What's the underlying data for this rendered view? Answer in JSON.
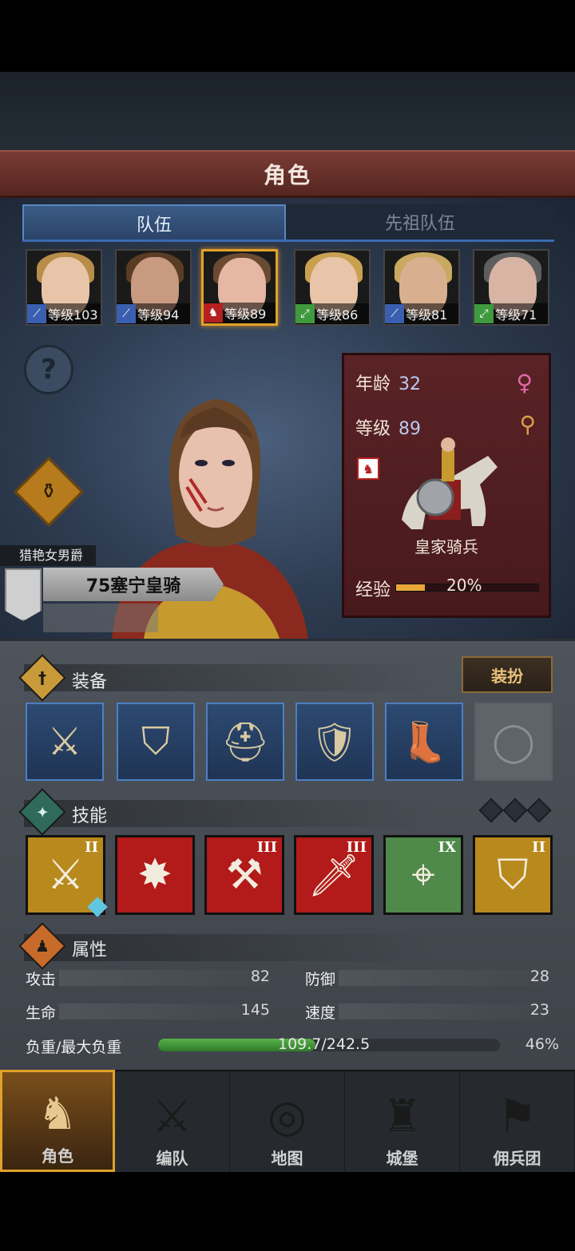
{
  "header": {
    "title": "角色"
  },
  "tabs": [
    {
      "label": "队伍"
    },
    {
      "label": "先祖队伍"
    }
  ],
  "party": [
    {
      "level_text": "等级103",
      "class_icon": "sword-icon",
      "class_color": "#3a5fb0",
      "hair": "#b88d4a",
      "skin": "#e8c4a8"
    },
    {
      "level_text": "等级94",
      "class_icon": "sword-icon",
      "class_color": "#3a5fb0",
      "hair": "#5a3c24",
      "skin": "#c89a80"
    },
    {
      "level_text": "等级89",
      "class_icon": "horse-icon",
      "class_color": "#b52020",
      "hair": "#6a4a30",
      "skin": "#e6b8a4"
    },
    {
      "level_text": "等级86",
      "class_icon": "bow-icon",
      "class_color": "#3f9a3f",
      "hair": "#c9a050",
      "skin": "#e8c4a8"
    },
    {
      "level_text": "等级81",
      "class_icon": "sword-icon",
      "class_color": "#3a5fb0",
      "hair": "#c9a860",
      "skin": "#d8b090"
    },
    {
      "level_text": "等级71",
      "class_icon": "bow-icon",
      "class_color": "#3f9a3f",
      "hair": "#5e5e5e",
      "skin": "#d8b4a4"
    }
  ],
  "hero": {
    "title": "猎艳女男爵",
    "name": "75塞宁皇骑",
    "age_label": "年龄",
    "age": "32",
    "level_label": "等级",
    "level": "89",
    "class_name": "皇家骑兵",
    "exp_label": "经验",
    "exp_percent": "20%",
    "exp_fraction": 0.2
  },
  "equipment": {
    "label": "装备",
    "outfit_button": "装扮",
    "slots": [
      {
        "name": "sword",
        "icon": "⚔",
        "empty": false
      },
      {
        "name": "shield",
        "icon": "⛉",
        "empty": false
      },
      {
        "name": "helmet",
        "icon": "⛑",
        "empty": false
      },
      {
        "name": "armor",
        "icon": "🛡",
        "empty": false
      },
      {
        "name": "boots",
        "icon": "👢",
        "empty": false
      },
      {
        "name": "ring",
        "icon": "◯",
        "empty": true
      }
    ]
  },
  "skills": {
    "label": "技能",
    "items": [
      {
        "name": "lance-charge",
        "rank": "II",
        "icon": "⚔",
        "bg": "#b8891c",
        "badge": "1"
      },
      {
        "name": "shield-bash",
        "rank": "",
        "icon": "✸",
        "bg": "#b31a1a",
        "badge": ""
      },
      {
        "name": "cleave",
        "rank": "III",
        "icon": "⚒",
        "bg": "#b31a1a",
        "badge": ""
      },
      {
        "name": "sword-strike",
        "rank": "III",
        "icon": "🗡",
        "bg": "#b31a1a",
        "badge": ""
      },
      {
        "name": "target",
        "rank": "IX",
        "icon": "⌖",
        "bg": "#4f8a4a",
        "badge": ""
      },
      {
        "name": "guard",
        "rank": "II",
        "icon": "⛉",
        "bg": "#b8891c",
        "badge": ""
      }
    ]
  },
  "attributes": {
    "label": "属性",
    "attack_label": "攻击",
    "attack": "82",
    "defense_label": "防御",
    "defense": "28",
    "hp_label": "生命",
    "hp": "145",
    "speed_label": "速度",
    "speed": "23",
    "load_label": "负重/最大负重",
    "load": "109.7/242.5",
    "load_percent": "46%",
    "load_fraction": 0.46
  },
  "nav": [
    {
      "label": "角色",
      "icon": "♞",
      "active": true
    },
    {
      "label": "编队",
      "icon": "⚔",
      "active": false
    },
    {
      "label": "地图",
      "icon": "◎",
      "active": false
    },
    {
      "label": "城堡",
      "icon": "♜",
      "active": false
    },
    {
      "label": "佣兵团",
      "icon": "⚑",
      "active": false
    }
  ],
  "colors": {
    "accent_gold": "#e0a12a",
    "panel_red": "#5a2326",
    "tab_blue": "#3a6bb0"
  }
}
